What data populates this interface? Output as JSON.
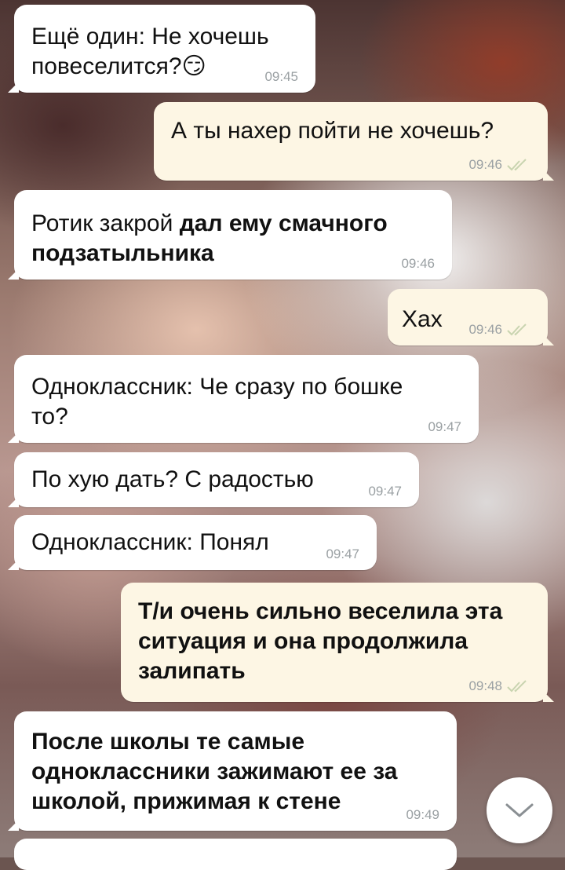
{
  "messages": [
    {
      "id": 1,
      "dir": "in",
      "bold": false,
      "text_lines": [
        "Ещё один: Не хочешь",
        "повеселится?😏"
      ],
      "time": "09:45",
      "read": false
    },
    {
      "id": 2,
      "dir": "out",
      "bold": false,
      "text_lines": [
        "А ты нахер пойти не хочешь?"
      ],
      "time": "09:46",
      "read": true
    },
    {
      "id": 3,
      "dir": "in",
      "bold": false,
      "text_lines": [
        "Ротик закрой",
        "подзатыльника"
      ],
      "bold_parts": [
        "дал ему смачного"
      ],
      "time": "09:46",
      "read": false
    },
    {
      "id": 4,
      "dir": "out",
      "bold": false,
      "text_lines": [
        "Хах"
      ],
      "time": "09:46",
      "read": true
    },
    {
      "id": 5,
      "dir": "in",
      "bold": false,
      "text_lines": [
        "Одноклассник: Че сразу по бошке",
        "то?"
      ],
      "time": "09:47",
      "read": false
    },
    {
      "id": 6,
      "dir": "in",
      "bold": false,
      "text_lines": [
        "По хую дать? С радостью"
      ],
      "time": "09:47",
      "read": false
    },
    {
      "id": 7,
      "dir": "in",
      "bold": false,
      "text_lines": [
        "Одноклассник: Понял"
      ],
      "time": "09:47",
      "read": false
    },
    {
      "id": 8,
      "dir": "out",
      "bold": true,
      "text_lines": [
        "Т/и очень сильно веселила эта",
        "ситуация и она продолжила",
        "залипать"
      ],
      "time": "09:48",
      "read": true
    },
    {
      "id": 9,
      "dir": "in",
      "bold": true,
      "text_lines": [
        "После школы те самые",
        "одноклассники зажимают ее за",
        "школой, прижимая к стене"
      ],
      "time": "09:49",
      "read": false
    }
  ],
  "colors": {
    "incoming_bubble": "#ffffff",
    "outgoing_bubble": "#fdf6e4",
    "timestamp": "#9aa0a3",
    "read_tick": "#c9d4b0"
  },
  "icons": {
    "read_receipt": "double-check-icon",
    "scroll_down": "chevron-down-icon"
  }
}
